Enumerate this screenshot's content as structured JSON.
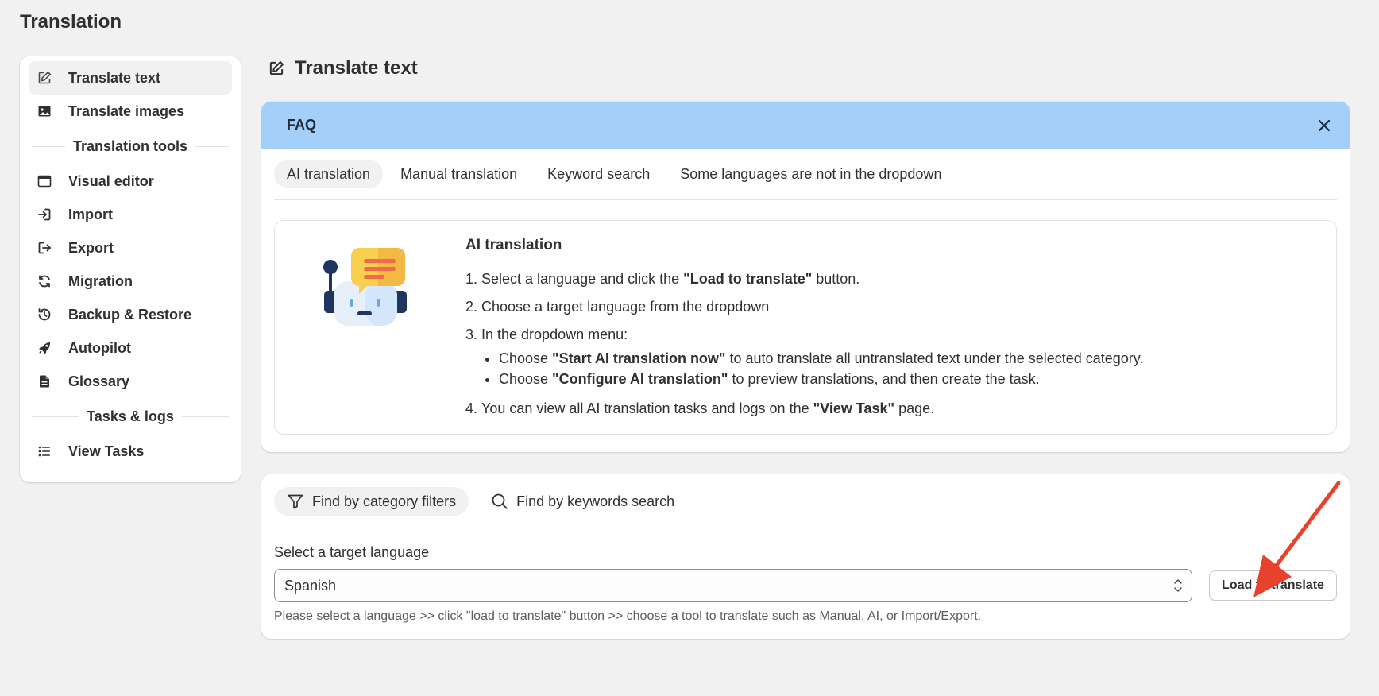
{
  "app": {
    "title": "Translation"
  },
  "sidebar": {
    "items_top": [
      {
        "label": "Translate text",
        "icon": "edit-icon",
        "active": true
      },
      {
        "label": "Translate images",
        "icon": "image-icon",
        "active": false
      }
    ],
    "section_tools": "Translation tools",
    "items_tools": [
      {
        "label": "Visual editor",
        "icon": "browser-window-icon"
      },
      {
        "label": "Import",
        "icon": "import-icon"
      },
      {
        "label": "Export",
        "icon": "export-icon"
      },
      {
        "label": "Migration",
        "icon": "refresh-icon"
      },
      {
        "label": "Backup & Restore",
        "icon": "history-icon"
      },
      {
        "label": "Autopilot",
        "icon": "rocket-icon"
      },
      {
        "label": "Glossary",
        "icon": "document-icon"
      }
    ],
    "section_tasks": "Tasks & logs",
    "items_tasks": [
      {
        "label": "View Tasks",
        "icon": "list-icon"
      }
    ]
  },
  "main": {
    "title": "Translate text",
    "faq": {
      "header": "FAQ",
      "tabs": [
        {
          "label": "AI translation",
          "active": true
        },
        {
          "label": "Manual translation",
          "active": false
        },
        {
          "label": "Keyword search",
          "active": false
        },
        {
          "label": "Some languages are not in the dropdown",
          "active": false
        }
      ],
      "content_title": "AI translation",
      "steps": {
        "s1_pre": "Select a language and click the ",
        "s1_bold": "\"Load to translate\"",
        "s1_post": " button.",
        "s2": "Choose a target language from the dropdown",
        "s3": "In the dropdown menu:",
        "s3a_pre": "Choose ",
        "s3a_bold": "\"Start AI translation now\"",
        "s3a_post": " to auto translate all untranslated text under the selected category.",
        "s3b_pre": "Choose ",
        "s3b_bold": "\"Configure AI translation\"",
        "s3b_post": " to preview translations, and then create the task.",
        "s4_pre": "You can view all AI translation tasks and logs on the ",
        "s4_bold": "\"View Task\"",
        "s4_post": " page."
      }
    },
    "filter": {
      "tabs": [
        {
          "label": "Find by category filters",
          "icon": "filter-icon",
          "active": true
        },
        {
          "label": "Find by keywords search",
          "icon": "search-icon",
          "active": false
        }
      ],
      "language_label": "Select a target language",
      "language_value": "Spanish",
      "load_button": "Load to translate",
      "help_text": "Please select a language >> click \"load to translate\" button >> choose a tool to translate such as Manual, AI, or Import/Export."
    }
  },
  "colors": {
    "faq_header": "#a3cff8",
    "annotation_arrow": "#e8412c"
  }
}
